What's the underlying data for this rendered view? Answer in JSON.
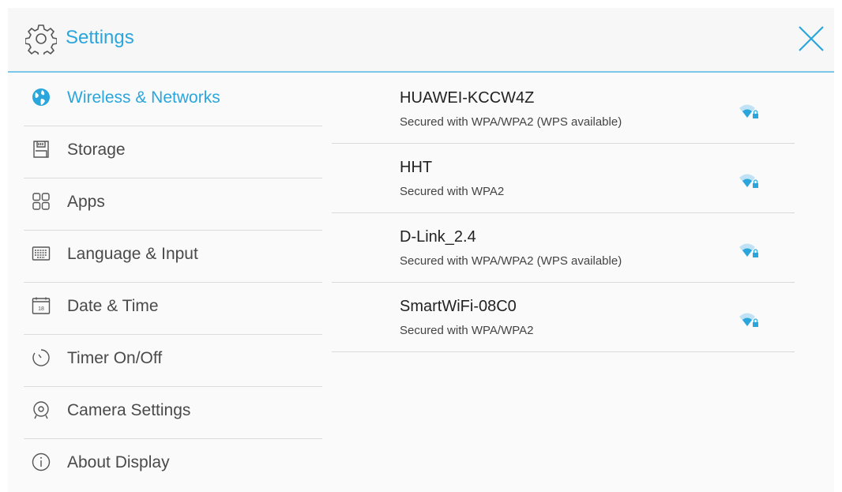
{
  "header": {
    "title": "Settings",
    "icon": "gear-icon",
    "close_icon": "close-icon",
    "accent_color": "#2aa6dc"
  },
  "sidebar": {
    "items": [
      {
        "label": "Wireless & Networks",
        "icon": "globe-icon",
        "active": true
      },
      {
        "label": "Storage",
        "icon": "storage-icon",
        "active": false
      },
      {
        "label": "Apps",
        "icon": "apps-grid-icon",
        "active": false
      },
      {
        "label": "Language & Input",
        "icon": "keyboard-icon",
        "active": false
      },
      {
        "label": "Date & Time",
        "icon": "calendar-icon",
        "active": false
      },
      {
        "label": "Timer On/Off",
        "icon": "timer-icon",
        "active": false
      },
      {
        "label": "Camera Settings",
        "icon": "camera-icon",
        "active": false
      },
      {
        "label": "About Display",
        "icon": "info-icon",
        "active": false
      }
    ]
  },
  "networks": [
    {
      "ssid": "HUAWEI-KCCW4Z",
      "security": "Secured with WPA/WPA2 (WPS available)",
      "icon": "wifi-locked-icon"
    },
    {
      "ssid": "HHT",
      "security": "Secured with WPA2",
      "icon": "wifi-locked-icon"
    },
    {
      "ssid": "D-Link_2.4",
      "security": "Secured with WPA/WPA2 (WPS available)",
      "icon": "wifi-locked-icon"
    },
    {
      "ssid": "SmartWiFi-08C0",
      "security": "Secured with WPA/WPA2",
      "icon": "wifi-locked-icon"
    }
  ]
}
